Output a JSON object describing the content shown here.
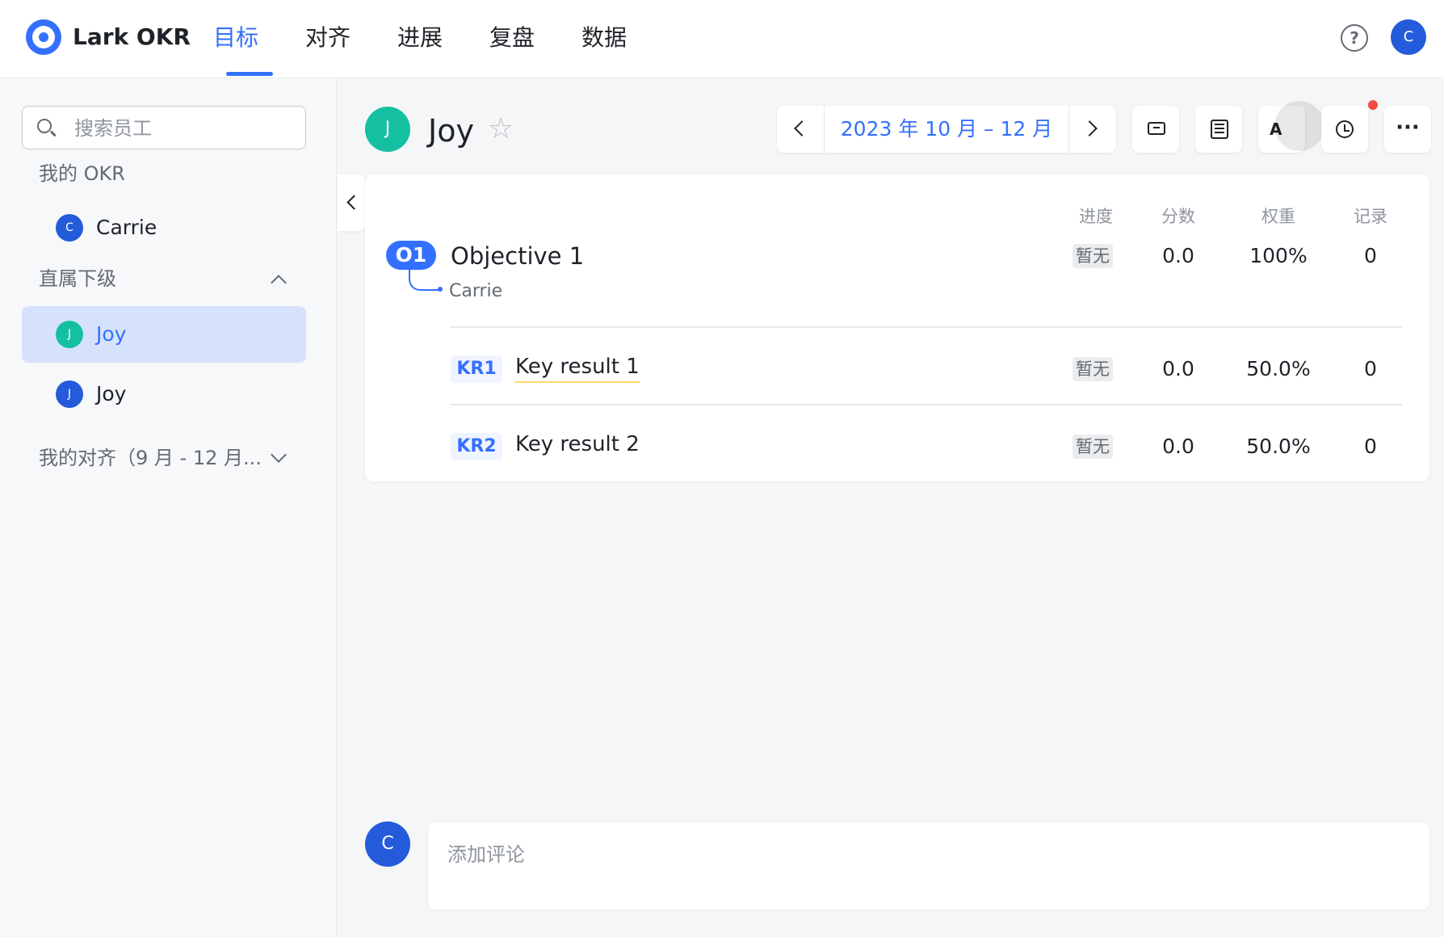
{
  "app": {
    "title": "Lark OKR"
  },
  "nav": {
    "items": [
      "目标",
      "对齐",
      "进展",
      "复盘",
      "数据"
    ],
    "active": "目标"
  },
  "header": {
    "help_symbol": "?",
    "user_initial": "C"
  },
  "sidebar": {
    "search_placeholder": "搜索员工",
    "my_okr": {
      "title": "我的 OKR",
      "items": [
        {
          "initial": "C",
          "name": "Carrie",
          "color": "#245bdb"
        }
      ]
    },
    "direct_reports": {
      "title": "直属下级",
      "items": [
        {
          "initial": "J",
          "name": "Joy",
          "color": "#14c0a0",
          "selected": true
        },
        {
          "initial": "J",
          "name": "Joy",
          "color": "#245bdb",
          "selected": false
        }
      ]
    },
    "my_alignment": {
      "title": "我的对齐（9 月 - 12 月..."
    }
  },
  "main": {
    "user": {
      "initial": "J",
      "name": "Joy"
    },
    "period": {
      "label": "2023 年 10 月 – 12 月"
    },
    "toolbar": {
      "translate_label": "A",
      "more_symbol": "···"
    },
    "columns": [
      "进度",
      "分数",
      "权重",
      "记录"
    ],
    "objective": {
      "badge": "O1",
      "title": "Objective 1",
      "owner": "Carrie",
      "progress": "暂无",
      "score": "0.0",
      "weight": "100%",
      "records": "0"
    },
    "key_results": [
      {
        "badge": "KR1",
        "title": "Key result 1",
        "progress": "暂无",
        "score": "0.0",
        "weight": "50.0%",
        "records": "0"
      },
      {
        "badge": "KR2",
        "title": "Key result 2",
        "progress": "暂无",
        "score": "0.0",
        "weight": "50.0%",
        "records": "0"
      }
    ]
  },
  "comment": {
    "placeholder": "添加评论",
    "user_initial": "C"
  },
  "colors": {
    "accent": "#3370ff",
    "selected_bg": "#d6e2fc",
    "notification": "#f54a45"
  }
}
